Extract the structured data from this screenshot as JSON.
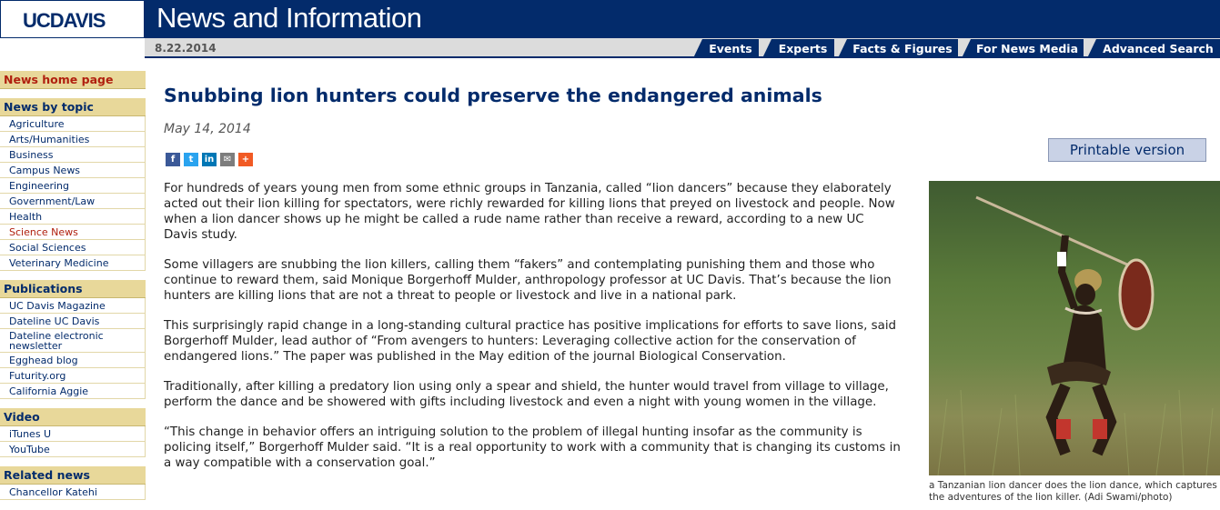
{
  "header": {
    "logo_uc": "UC",
    "logo_davis": "DAVIS",
    "site_title": "News and Information",
    "date": "8.22.2014",
    "nav": [
      "Events",
      "Experts",
      "Facts & Figures",
      "For News Media",
      "Advanced Search"
    ]
  },
  "sidebar": {
    "home": "News home page",
    "topics_heading": "News by topic",
    "topics": [
      "Agriculture",
      "Arts/Humanities",
      "Business",
      "Campus News",
      "Engineering",
      "Government/Law",
      "Health",
      "Science News",
      "Social Sciences",
      "Veterinary Medicine"
    ],
    "publications_heading": "Publications",
    "publications": [
      "UC Davis Magazine",
      "Dateline UC Davis",
      "Dateline electronic newsletter",
      "Egghead blog",
      "Futurity.org",
      "California Aggie"
    ],
    "video_heading": "Video",
    "video": [
      "iTunes U",
      "YouTube"
    ],
    "related_heading": "Related news",
    "related": [
      "Chancellor Katehi"
    ]
  },
  "article": {
    "title": "Snubbing lion hunters could preserve the endangered animals",
    "date": "May 14, 2014",
    "printable": "Printable version",
    "share_icons": [
      "facebook-icon",
      "twitter-icon",
      "linkedin-icon",
      "email-icon",
      "plus-icon"
    ],
    "paragraphs": [
      "For hundreds of years young men from some ethnic groups in Tanzania, called “lion dancers” because they elaborately acted out their lion killing for spectators, were richly rewarded for killing lions that preyed on livestock and people. Now when a lion dancer shows up he might be called a rude name rather than receive a reward, according to a new UC Davis study.",
      "Some villagers are snubbing the lion killers, calling them “fakers” and contemplating punishing them and those who continue to reward them, said Monique Borgerhoff Mulder, anthropology professor at UC Davis. That’s because the lion hunters are killing lions that are not a threat to people or livestock and live in a national park.",
      "This surprisingly rapid change in a long-standing cultural practice has positive implications for efforts to save lions, said Borgerhoff Mulder, lead author of “From avengers to hunters: Leveraging collective action for the conservation of endangered lions.” The paper was published in the May edition of the journal Biological Conservation.",
      "Traditionally, after killing a predatory lion using only a spear and shield, the hunter would travel from village to village, perform the dance and be showered with gifts including livestock and even a night with young women in the village.",
      "“This change in behavior offers an intriguing solution to the problem of illegal hunting insofar as the community is policing itself,” Borgerhoff Mulder said. “It is a real opportunity to work with a community that is changing its customs in a way compatible with a conservation goal.”"
    ],
    "caption": "a Tanzanian lion dancer does the lion dance, which captures the adventures of the lion killer. (Adi Swami/photo)"
  },
  "colors": {
    "navy": "#032b6b",
    "sidebar_header": "#e8d89a",
    "active_link": "#b0200f"
  }
}
